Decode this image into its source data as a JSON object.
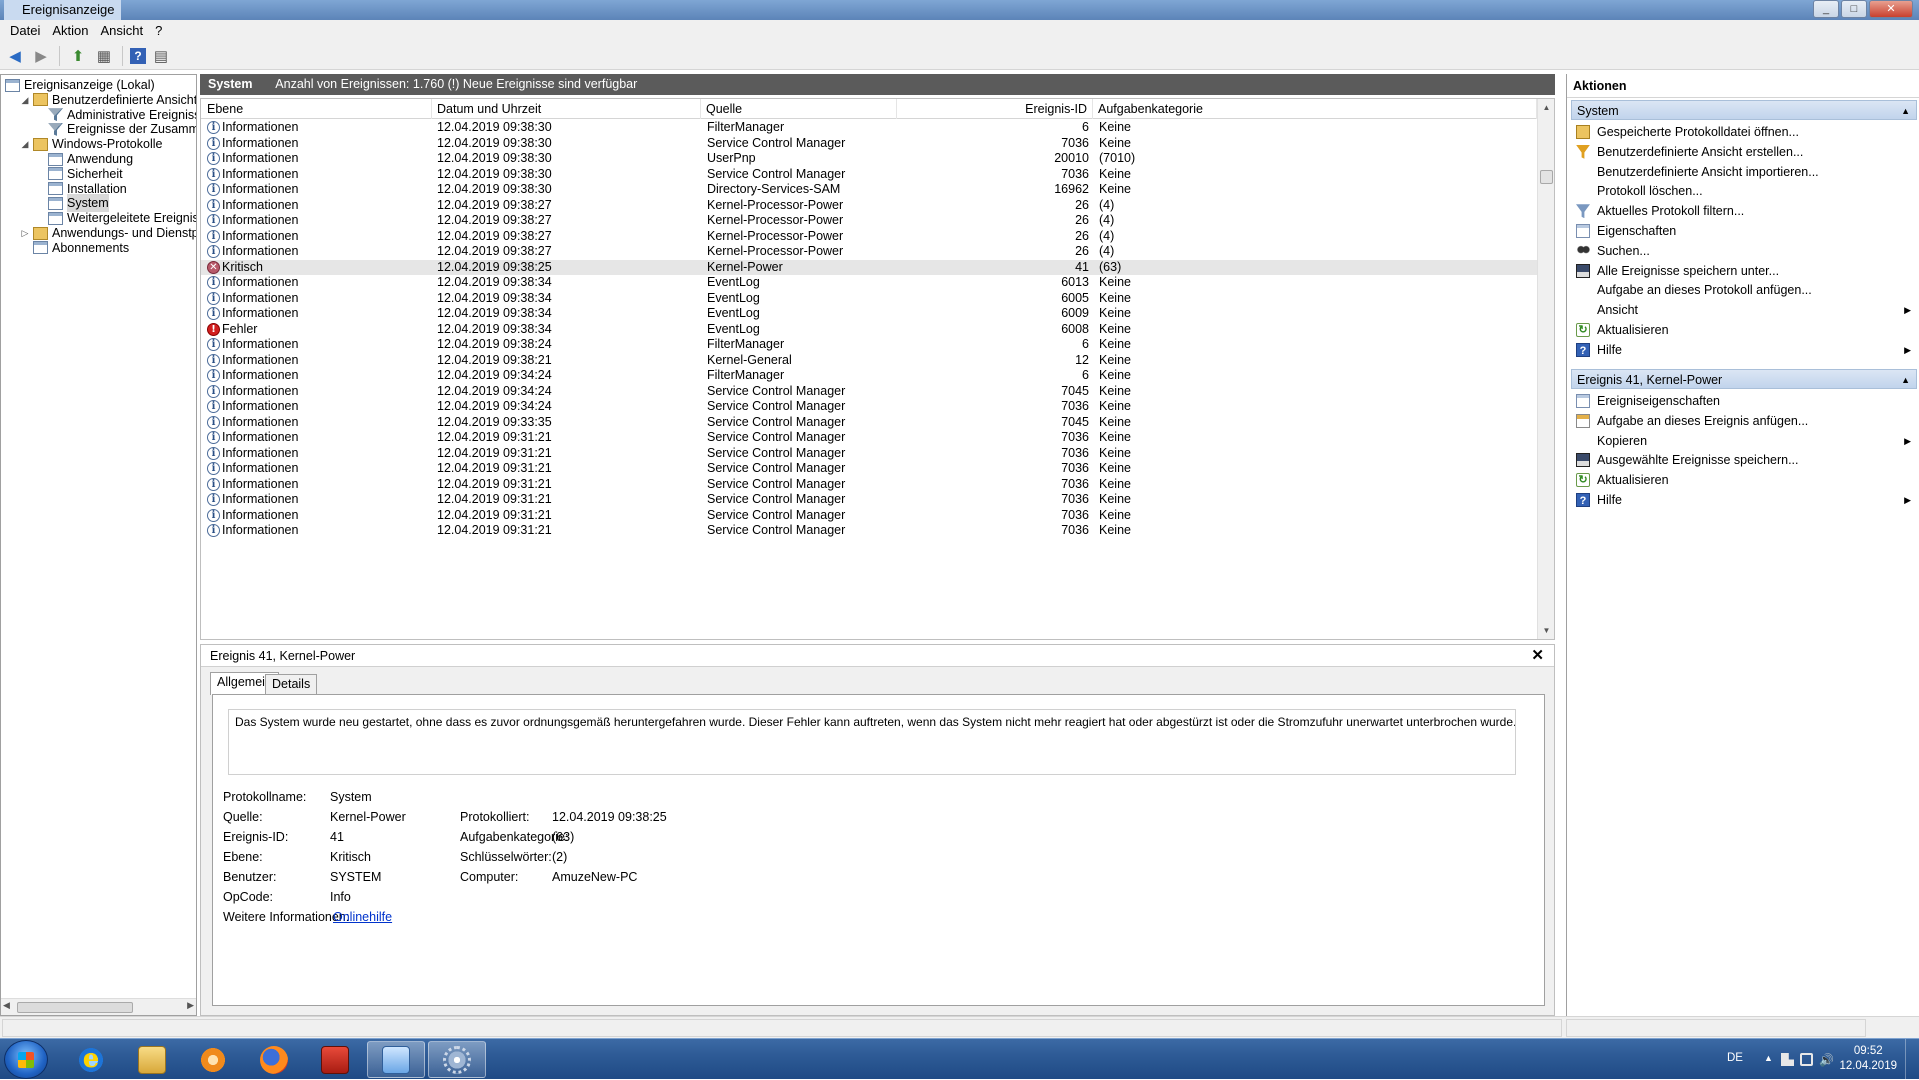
{
  "window": {
    "title": "Ereignisanzeige",
    "min": "0",
    "max": "1",
    "close": "r"
  },
  "menu": [
    "Datei",
    "Aktion",
    "Ansicht",
    "?"
  ],
  "tree": [
    {
      "label": "Ereignisanzeige (Lokal)",
      "level": 0,
      "icon": "event-viewer-icon",
      "expander": ""
    },
    {
      "label": "Benutzerdefinierte Ansichten",
      "level": 1,
      "icon": "folder-icon",
      "expander": "◢"
    },
    {
      "label": "Administrative Ereignisse",
      "level": 2,
      "icon": "filter-icon",
      "expander": ""
    },
    {
      "label": "Ereignisse der Zusammenfassung",
      "level": 2,
      "icon": "filter-icon",
      "expander": ""
    },
    {
      "label": "Windows-Protokolle",
      "level": 1,
      "icon": "folder-icon",
      "expander": "◢"
    },
    {
      "label": "Anwendung",
      "level": 2,
      "icon": "log-icon",
      "expander": ""
    },
    {
      "label": "Sicherheit",
      "level": 2,
      "icon": "log-icon",
      "expander": ""
    },
    {
      "label": "Installation",
      "level": 2,
      "icon": "log-icon",
      "expander": ""
    },
    {
      "label": "System",
      "level": 2,
      "icon": "log-icon",
      "expander": "",
      "selected": true
    },
    {
      "label": "Weitergeleitete Ereignisse",
      "level": 2,
      "icon": "log-icon",
      "expander": ""
    },
    {
      "label": "Anwendungs- und Dienstprotokolle",
      "level": 1,
      "icon": "folder-icon",
      "expander": "▷"
    },
    {
      "label": "Abonnements",
      "level": 1,
      "icon": "log-icon",
      "expander": ""
    }
  ],
  "log_header": {
    "name": "System",
    "info": "Anzahl von Ereignissen: 1.760 (!) Neue Ereignisse sind verfügbar"
  },
  "columns": {
    "level": "Ebene",
    "datetime": "Datum und Uhrzeit",
    "source": "Quelle",
    "event_id": "Ereignis-ID",
    "category": "Aufgabenkategorie"
  },
  "events": [
    {
      "type": "info",
      "level": "Informationen",
      "datetime": "12.04.2019 09:38:30",
      "source": "FilterManager",
      "id": "6",
      "category": "Keine"
    },
    {
      "type": "info",
      "level": "Informationen",
      "datetime": "12.04.2019 09:38:30",
      "source": "Service Control Manager",
      "id": "7036",
      "category": "Keine"
    },
    {
      "type": "info",
      "level": "Informationen",
      "datetime": "12.04.2019 09:38:30",
      "source": "UserPnp",
      "id": "20010",
      "category": "(7010)"
    },
    {
      "type": "info",
      "level": "Informationen",
      "datetime": "12.04.2019 09:38:30",
      "source": "Service Control Manager",
      "id": "7036",
      "category": "Keine"
    },
    {
      "type": "info",
      "level": "Informationen",
      "datetime": "12.04.2019 09:38:30",
      "source": "Directory-Services-SAM",
      "id": "16962",
      "category": "Keine"
    },
    {
      "type": "info",
      "level": "Informationen",
      "datetime": "12.04.2019 09:38:27",
      "source": "Kernel-Processor-Power",
      "id": "26",
      "category": "(4)"
    },
    {
      "type": "info",
      "level": "Informationen",
      "datetime": "12.04.2019 09:38:27",
      "source": "Kernel-Processor-Power",
      "id": "26",
      "category": "(4)"
    },
    {
      "type": "info",
      "level": "Informationen",
      "datetime": "12.04.2019 09:38:27",
      "source": "Kernel-Processor-Power",
      "id": "26",
      "category": "(4)"
    },
    {
      "type": "info",
      "level": "Informationen",
      "datetime": "12.04.2019 09:38:27",
      "source": "Kernel-Processor-Power",
      "id": "26",
      "category": "(4)"
    },
    {
      "type": "crit",
      "level": "Kritisch",
      "datetime": "12.04.2019 09:38:25",
      "source": "Kernel-Power",
      "id": "41",
      "category": "(63)",
      "highlight": true
    },
    {
      "type": "info",
      "level": "Informationen",
      "datetime": "12.04.2019 09:38:34",
      "source": "EventLog",
      "id": "6013",
      "category": "Keine"
    },
    {
      "type": "info",
      "level": "Informationen",
      "datetime": "12.04.2019 09:38:34",
      "source": "EventLog",
      "id": "6005",
      "category": "Keine"
    },
    {
      "type": "info",
      "level": "Informationen",
      "datetime": "12.04.2019 09:38:34",
      "source": "EventLog",
      "id": "6009",
      "category": "Keine"
    },
    {
      "type": "err",
      "level": "Fehler",
      "datetime": "12.04.2019 09:38:34",
      "source": "EventLog",
      "id": "6008",
      "category": "Keine"
    },
    {
      "type": "info",
      "level": "Informationen",
      "datetime": "12.04.2019 09:38:24",
      "source": "FilterManager",
      "id": "6",
      "category": "Keine"
    },
    {
      "type": "info",
      "level": "Informationen",
      "datetime": "12.04.2019 09:38:21",
      "source": "Kernel-General",
      "id": "12",
      "category": "Keine"
    },
    {
      "type": "info",
      "level": "Informationen",
      "datetime": "12.04.2019 09:34:24",
      "source": "FilterManager",
      "id": "6",
      "category": "Keine"
    },
    {
      "type": "info",
      "level": "Informationen",
      "datetime": "12.04.2019 09:34:24",
      "source": "Service Control Manager",
      "id": "7045",
      "category": "Keine"
    },
    {
      "type": "info",
      "level": "Informationen",
      "datetime": "12.04.2019 09:34:24",
      "source": "Service Control Manager",
      "id": "7036",
      "category": "Keine"
    },
    {
      "type": "info",
      "level": "Informationen",
      "datetime": "12.04.2019 09:33:35",
      "source": "Service Control Manager",
      "id": "7045",
      "category": "Keine"
    },
    {
      "type": "info",
      "level": "Informationen",
      "datetime": "12.04.2019 09:31:21",
      "source": "Service Control Manager",
      "id": "7036",
      "category": "Keine"
    },
    {
      "type": "info",
      "level": "Informationen",
      "datetime": "12.04.2019 09:31:21",
      "source": "Service Control Manager",
      "id": "7036",
      "category": "Keine"
    },
    {
      "type": "info",
      "level": "Informationen",
      "datetime": "12.04.2019 09:31:21",
      "source": "Service Control Manager",
      "id": "7036",
      "category": "Keine"
    },
    {
      "type": "info",
      "level": "Informationen",
      "datetime": "12.04.2019 09:31:21",
      "source": "Service Control Manager",
      "id": "7036",
      "category": "Keine"
    },
    {
      "type": "info",
      "level": "Informationen",
      "datetime": "12.04.2019 09:31:21",
      "source": "Service Control Manager",
      "id": "7036",
      "category": "Keine"
    },
    {
      "type": "info",
      "level": "Informationen",
      "datetime": "12.04.2019 09:31:21",
      "source": "Service Control Manager",
      "id": "7036",
      "category": "Keine"
    },
    {
      "type": "info",
      "level": "Informationen",
      "datetime": "12.04.2019 09:31:21",
      "source": "Service Control Manager",
      "id": "7036",
      "category": "Keine"
    }
  ],
  "detail": {
    "title": "Ereignis 41, Kernel-Power",
    "close": "✕",
    "tabs": [
      "Allgemein",
      "Details"
    ],
    "description": "Das System wurde neu gestartet, ohne dass es zuvor ordnungsgemäß heruntergefahren wurde. Dieser Fehler kann auftreten, wenn das System nicht mehr reagiert hat oder abgestürzt ist oder die Stromzufuhr unerwartet unterbrochen wurde.",
    "log_name_label": "Protokollname:",
    "log_name": "System",
    "source_label": "Quelle:",
    "source": "Kernel-Power",
    "logged_label": "Protokolliert:",
    "logged": "12.04.2019 09:38:25",
    "event_id_label": "Ereignis-ID:",
    "event_id": "41",
    "task_cat_label": "Aufgabenkategorie:",
    "task_cat": "(63)",
    "level_label": "Ebene:",
    "level": "Kritisch",
    "keywords_label": "Schlüsselwörter:",
    "keywords": "(2)",
    "user_label": "Benutzer:",
    "user": "SYSTEM",
    "computer_label": "Computer:",
    "computer": "AmuzeNew-PC",
    "opcode_label": "OpCode:",
    "opcode": "Info",
    "more_label": "Weitere Informationen:",
    "more_link": "Onlinehilfe"
  },
  "actions": {
    "title": "Aktionen",
    "section1": "System",
    "items1": [
      {
        "label": "Gespeicherte Protokolldatei öffnen...",
        "icon": "open-icon",
        "sub": false
      },
      {
        "label": "Benutzerdefinierte Ansicht erstellen...",
        "icon": "filter-create-icon",
        "sub": false
      },
      {
        "label": "Benutzerdefinierte Ansicht importieren...",
        "icon": "",
        "sub": false
      },
      {
        "label": "Protokoll löschen...",
        "icon": "",
        "sub": false
      },
      {
        "label": "Aktuelles Protokoll filtern...",
        "icon": "filter-icon",
        "sub": false
      },
      {
        "label": "Eigenschaften",
        "icon": "properties-icon",
        "sub": false
      },
      {
        "label": "Suchen...",
        "icon": "binoculars-icon",
        "sub": false
      },
      {
        "label": "Alle Ereignisse speichern unter...",
        "icon": "save-icon",
        "sub": false
      },
      {
        "label": "Aufgabe an dieses Protokoll anfügen...",
        "icon": "",
        "sub": false
      },
      {
        "label": "Ansicht",
        "icon": "",
        "sub": true
      },
      {
        "label": "Aktualisieren",
        "icon": "refresh-icon",
        "sub": false
      },
      {
        "label": "Hilfe",
        "icon": "help-icon",
        "sub": true
      }
    ],
    "section2": "Ereignis 41, Kernel-Power",
    "items2": [
      {
        "label": "Ereigniseigenschaften",
        "icon": "properties-icon",
        "sub": false
      },
      {
        "label": "Aufgabe an dieses Ereignis anfügen...",
        "icon": "task-icon",
        "sub": false
      },
      {
        "label": "Kopieren",
        "icon": "",
        "sub": true
      },
      {
        "label": "Ausgewählte Ereignisse speichern...",
        "icon": "save-icon",
        "sub": false
      },
      {
        "label": "Aktualisieren",
        "icon": "refresh-icon",
        "sub": false
      },
      {
        "label": "Hilfe",
        "icon": "help-icon",
        "sub": true
      }
    ]
  },
  "taskbar": {
    "lang": "DE",
    "time": "09:52",
    "date": "12.04.2019"
  }
}
